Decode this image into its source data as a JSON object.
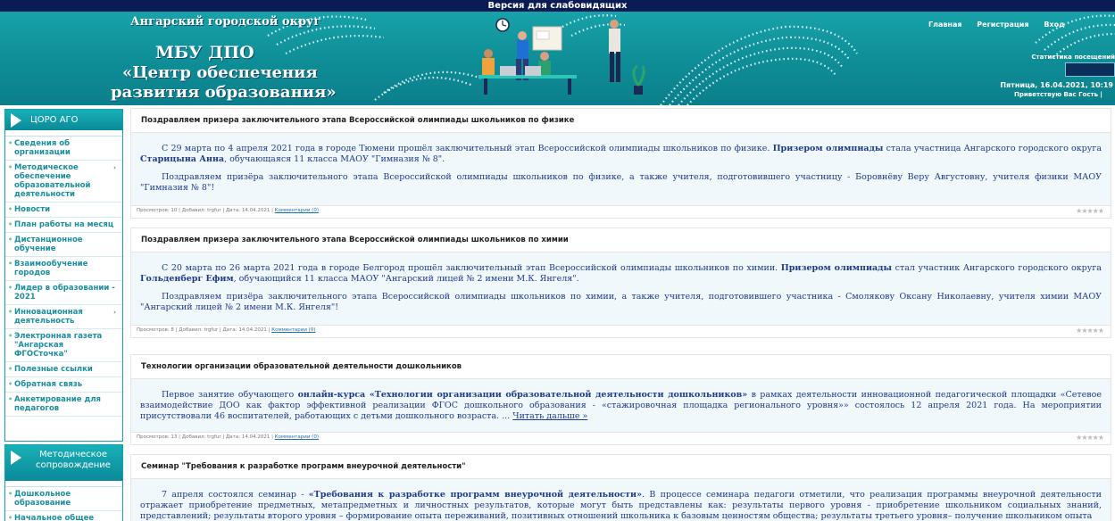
{
  "header": {
    "accessibility_version": "Версия для слабовидящих",
    "okrug": "Ангарский городской округ",
    "title_line1": "МБУ ДПО",
    "title_line2": "«Центр обеспечения",
    "title_line3": "развития образования»",
    "nav": [
      "Главная",
      "Регистрация",
      "Вход"
    ],
    "stats_title": "Статистика посещений",
    "datetime": "Пятница, 16.04.2021, 10:19",
    "greeting": "Приветствую Вас Гость |"
  },
  "sidebar": {
    "block1_title": "ЦОРО АГО",
    "menu1": [
      {
        "label": "Сведения об организации",
        "submenu": false
      },
      {
        "label": "Методическое обеспечение образовательной деятельности",
        "submenu": true
      },
      {
        "label": "Новости",
        "submenu": false
      },
      {
        "label": "План работы на месяц",
        "submenu": false
      },
      {
        "label": "Дистанционное обучение",
        "submenu": false
      },
      {
        "label": "Взаимообучение городов",
        "submenu": false
      },
      {
        "label": "Лидер в образовании - 2021",
        "submenu": false
      },
      {
        "label": "Инновационная деятельность",
        "submenu": true
      },
      {
        "label": "Электронная газета \"Ангарская ФГОСточка\"",
        "submenu": false
      },
      {
        "label": "Полезные ссылки",
        "submenu": false
      },
      {
        "label": "Обратная связь",
        "submenu": false
      },
      {
        "label": "Анкетирование для педагогов",
        "submenu": false
      }
    ],
    "block2_title": "Методическое сопровождение",
    "menu2": [
      {
        "label": "Дошкольное образование",
        "submenu": false
      },
      {
        "label": "Начальное общее",
        "submenu": false
      }
    ]
  },
  "articles": [
    {
      "title": "Поздравляем призера заключительного этапа Всероссийской олимпиады школьников по физике",
      "p1_a": "С 29 марта по 4 апреля 2021 года в городе Тюмени прошёл заключительный этап Всероссийской олимпиады школьников по физике.",
      "p1_b": "Призером олимпиады",
      "p1_c": "стала участница Ангарского городского округа",
      "p1_d": "Старицына Анна",
      "p1_e": ", обучающаяся 11 класса МАОУ \"Гимназия № 8\".",
      "p2": "Поздравляем призёра заключительного этапа Всероссийской олимпиады школьников по физике, а также учителя, подготовившего участницу - Боровнёву Веру Августовну, учителя физики МАОУ \"Гимназия № 8\"!",
      "meta": "Просмотров: 10 | Добавил: trgfur | Дата: 14.04.2021 |",
      "comments": "Комментарии (0)"
    },
    {
      "title": "Поздравляем призера заключительного этапа Всероссийской олимпиады школьников по химии",
      "p1_a": "С 20 марта по 26 марта 2021 года в городе Белгород прошёл заключительный этап Всероссийской олимпиады школьников по химии.",
      "p1_b": "Призером олимпиады",
      "p1_c": "стал участник Ангарского городского округа",
      "p1_d": "Гольденберг Ефим",
      "p1_e": ", обучающийся 11 класса МАОУ \"Ангарский лицей № 2 имени М.К. Янгеля\".",
      "p2": "Поздравляем призёра заключительного этапа Всероссийской олимпиады школьников по химии, а также учителя, подготовившего участника - Смолякову Оксану Николаевну, учителя химии МАОУ \"Ангарский лицей № 2 имени М.К. Янгеля\"!",
      "meta": "Просмотров: 8 | Добавил: trgfur | Дата: 14.04.2021 |",
      "comments": "Комментарии (0)"
    },
    {
      "title": "Технологии организации образовательной деятельности дошкольников",
      "p1_a": "Первое занятие обучающего",
      "p1_b": "онлайн-курса «Технологии организации образовательной деятельности дошкольников»",
      "p1_c": "в рамках деятельности инновационной педагогической площадки «Сетевое взаимодействие ДОО как фактор эффективной реализации ФГОС дошкольного образования - «стажировочная площадка регионального уровня»» состоялось 12 апреля 2021 года. На мероприятии присутствовали 46 воспитателей, работающих с детьми дошкольного возраста. ...",
      "more": "Читать дальше »",
      "meta": "Просмотров: 13 | Добавил: trgfur | Дата: 14.04.2021 |",
      "comments": "Комментарии (0)"
    },
    {
      "title": "Семинар \"Требования к разработке программ внеурочной деятельности\"",
      "p1_a": "7 апреля состоялся семинар -",
      "p1_b": "«Требования к разработке программ внеурочной деятельности»",
      "p1_c": ". В процессе семинара педагоги отметили, что реализация программы внеурочной деятельности отражает приобретение предметных, метапредметных и личностных результатов, которые могут быть представлены как: результаты первого уровня - приобретение школьником социальных знаний, представлений; результаты второго уровня – формирование опыта переживаний, позитивных отношений школьника к базовым ценностям общества; результаты третьего уровня– получение школьником опыта"
    }
  ],
  "rating_stars": "★★★★★"
}
